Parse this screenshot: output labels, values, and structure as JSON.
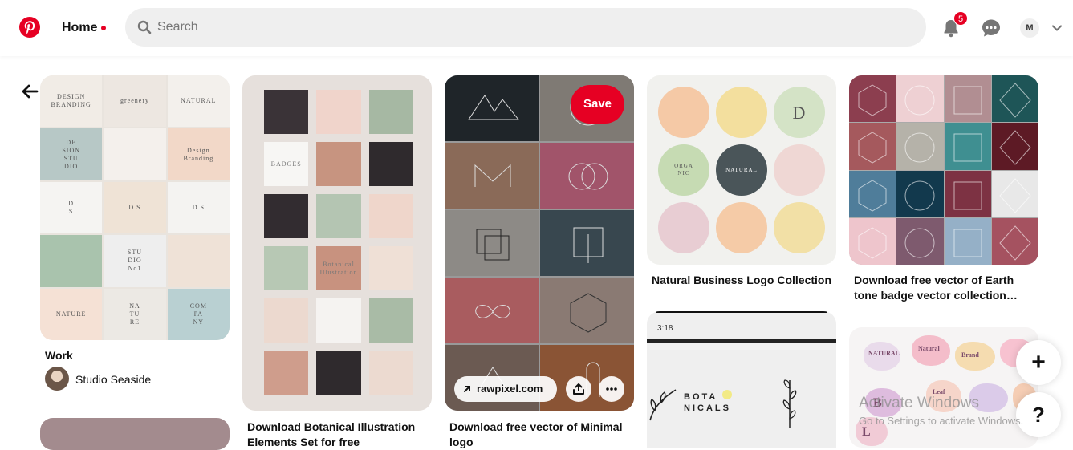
{
  "header": {
    "logo_icon": "pinterest-logo-icon",
    "home_label": "Home",
    "search_placeholder": "Search",
    "notification_count": "5",
    "avatar_initial": "M",
    "accent_color": "#e60023"
  },
  "pins": [
    {
      "caption": "Work",
      "author": "Studio Seaside"
    },
    {
      "caption": "Download Botanical Illustration Elements Set for free"
    },
    {
      "caption": "Download free vector of Minimal logo",
      "save_label": "Save",
      "link_label": "rawpixel.com"
    },
    {
      "caption": "Natural Business Logo Collection"
    },
    {
      "caption": "Download free vector of Earth tone badge vector collection…"
    }
  ],
  "pin1_tiles": [
    {
      "text": "DESIGN\nBRANDING",
      "bg": "#f1ece6"
    },
    {
      "text": "greenery",
      "bg": "#ede7e1"
    },
    {
      "text": "NATURAL",
      "bg": "#f3f0ec"
    },
    {
      "text": "DE\nSION\nSTU\nDIO",
      "bg": "#b7c8c6"
    },
    {
      "text": "",
      "bg": "#f4f0ec"
    },
    {
      "text": "Design\nBranding",
      "bg": "#f2d8c8"
    },
    {
      "text": "D\nS",
      "bg": "#f5f4f2"
    },
    {
      "text": "D S",
      "bg": "#efe3d6"
    },
    {
      "text": "D S",
      "bg": "#f4f3f1"
    },
    {
      "text": "",
      "bg": "#a9c3ad"
    },
    {
      "text": "STU\nDIO\nNo1",
      "bg": "#eeeeee"
    },
    {
      "text": "",
      "bg": "#efe2d7"
    },
    {
      "text": "NATURE",
      "bg": "#f5e1d5"
    },
    {
      "text": "NA\nTU\nRE",
      "bg": "#ece9e4"
    },
    {
      "text": "COM\nPA\nNY",
      "bg": "#b9d0d2"
    }
  ],
  "pin2_tiles": [
    {
      "text": "",
      "bg": "#3a3337"
    },
    {
      "text": "",
      "bg": "#f0d4cb"
    },
    {
      "text": "",
      "bg": "#a6b8a3"
    },
    {
      "text": "BADGES",
      "bg": "#f7f6f4"
    },
    {
      "text": "",
      "bg": "#c79480"
    },
    {
      "text": "",
      "bg": "#2f2a2d"
    },
    {
      "text": "",
      "bg": "#322c30"
    },
    {
      "text": "",
      "bg": "#b4c5b2"
    },
    {
      "text": "",
      "bg": "#efd6cb"
    },
    {
      "text": "",
      "bg": "#b7c8b4"
    },
    {
      "text": "Botanical\nIllustration",
      "bg": "#c8927f"
    },
    {
      "text": "",
      "bg": "#efe0d6"
    },
    {
      "text": "",
      "bg": "#ecd9cf"
    },
    {
      "text": "",
      "bg": "#f5f3f1"
    },
    {
      "text": "",
      "bg": "#a9bba6"
    },
    {
      "text": "",
      "bg": "#cf9d8c"
    },
    {
      "text": "",
      "bg": "#2f2a2d"
    },
    {
      "text": "",
      "bg": "#ecdad0"
    }
  ],
  "pin3_tiles": [
    {
      "bg": "#1f2529"
    },
    {
      "bg": "#7f7a74"
    },
    {
      "bg": "#8a6a58"
    },
    {
      "bg": "#a1546a"
    },
    {
      "bg": "#8d8a86"
    },
    {
      "bg": "#38474f"
    },
    {
      "bg": "#a95c5f"
    },
    {
      "bg": "#8a7a73"
    },
    {
      "bg": "#6b5a52"
    },
    {
      "bg": "#8a5435"
    }
  ],
  "pin4_badges": [
    {
      "text": "",
      "color": "#f5c9a6"
    },
    {
      "text": "",
      "color": "#f3df9e"
    },
    {
      "text": "D",
      "color": "#d4e3c6"
    },
    {
      "text": "ORGA\nNIC",
      "color": "#c6dbb3"
    },
    {
      "text": "NATURAL",
      "color": "#4a5559"
    },
    {
      "text": "",
      "color": "#efd7d4"
    },
    {
      "text": "",
      "color": "#e8cdd3"
    },
    {
      "text": "",
      "color": "#f5cba7"
    },
    {
      "text": "",
      "color": "#f2e0a6"
    }
  ],
  "pin5_tiles": [
    {
      "bg": "#8c3e4f"
    },
    {
      "bg": "#eed0d3"
    },
    {
      "bg": "#b18e92"
    },
    {
      "bg": "#1e5557"
    },
    {
      "bg": "#a5595d"
    },
    {
      "bg": "#b5b2a9"
    },
    {
      "bg": "#3f8f91"
    },
    {
      "bg": "#5d1a25"
    },
    {
      "bg": "#4f7d9a"
    },
    {
      "bg": "#12394d"
    },
    {
      "bg": "#7d3243"
    },
    {
      "bg": "#e8e8e8"
    },
    {
      "bg": "#eec5cc"
    },
    {
      "bg": "#7e5a6e"
    },
    {
      "bg": "#95b0c7"
    },
    {
      "bg": "#a55260"
    }
  ],
  "pin6": {
    "timer": "3:18",
    "text": "BOTA\nNICALS"
  },
  "pin7_labels": [
    "NATURAL",
    "Natural",
    "Brand",
    "Leaf",
    "B",
    "L"
  ],
  "floating": {
    "add_label": "+",
    "help_label": "?"
  },
  "overlay": {
    "activate_title": "Activate Windows",
    "activate_sub": "Go to Settings to activate Windows."
  }
}
